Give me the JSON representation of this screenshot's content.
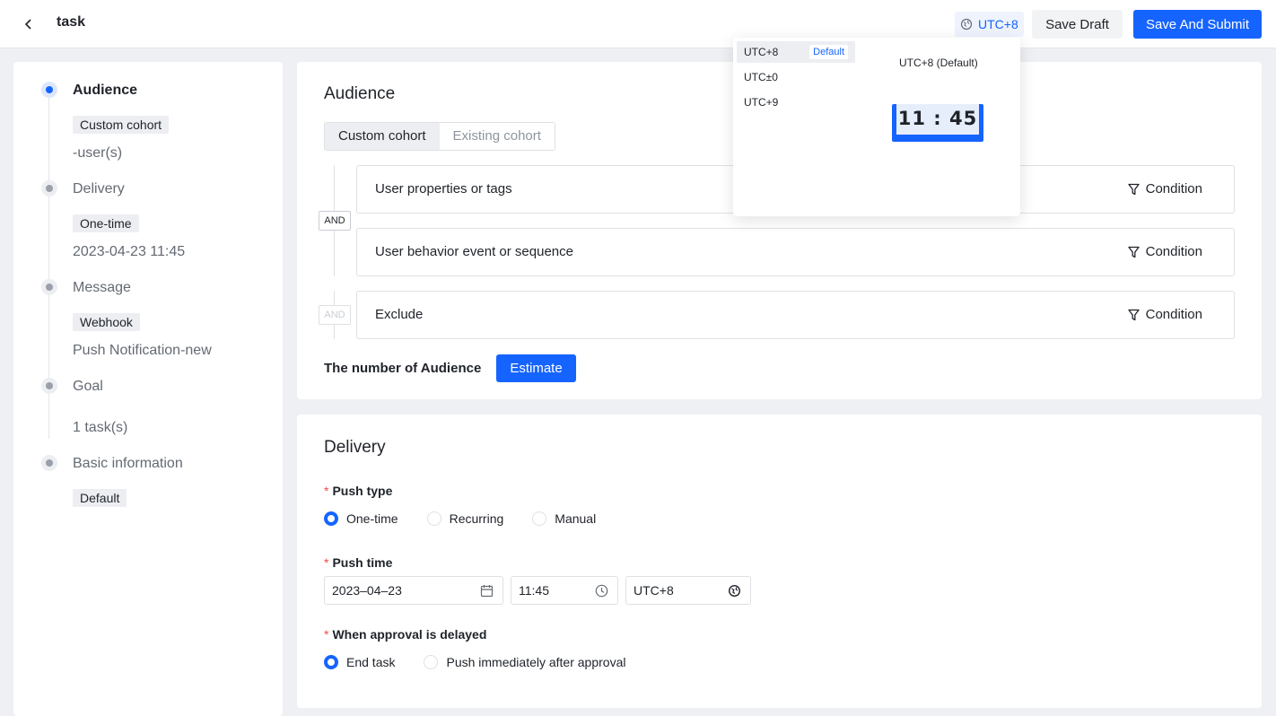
{
  "header": {
    "title": "task",
    "timezone": "UTC+8",
    "save_draft_label": "Save Draft",
    "save_submit_label": "Save And Submit"
  },
  "sidebar": {
    "steps": [
      {
        "title": "Audience",
        "tag": "Custom cohort",
        "sub": "-user(s)",
        "active": true
      },
      {
        "title": "Delivery",
        "tag": "One-time",
        "sub": "2023-04-23 11:45"
      },
      {
        "title": "Message",
        "tag": "Webhook",
        "sub": "Push Notification-new"
      },
      {
        "title": "Goal",
        "sub": "1 task(s)"
      },
      {
        "title": "Basic information",
        "tag": "Default"
      }
    ]
  },
  "audience": {
    "title": "Audience",
    "tabs": [
      "Custom cohort",
      "Existing cohort"
    ],
    "and_label": "AND",
    "conditions": [
      {
        "label": "User properties or tags",
        "action": "Condition"
      },
      {
        "label": "User behavior event or sequence",
        "action": "Condition"
      },
      {
        "label": "Exclude",
        "action": "Condition"
      }
    ],
    "count_label": "The number of Audience",
    "estimate_label": "Estimate"
  },
  "delivery": {
    "title": "Delivery",
    "push_type_label": "Push type",
    "push_type_options": [
      "One-time",
      "Recurring",
      "Manual"
    ],
    "push_time_label": "Push time",
    "date_value": "2023–04–23",
    "time_value": "11:45",
    "tz_value": "UTC+8",
    "approval_label": "When approval is delayed",
    "approval_options": [
      "End task",
      "Push immediately after approval"
    ]
  },
  "tz_popup": {
    "options": [
      "UTC+8",
      "UTC±0",
      "UTC+9"
    ],
    "default_badge": "Default",
    "preview_label": "UTC+8 (Default)",
    "clock_time": "11 : 45"
  },
  "colors": {
    "accent": "#1664ff",
    "background": "#eef0f4",
    "required": "#f54a45"
  }
}
